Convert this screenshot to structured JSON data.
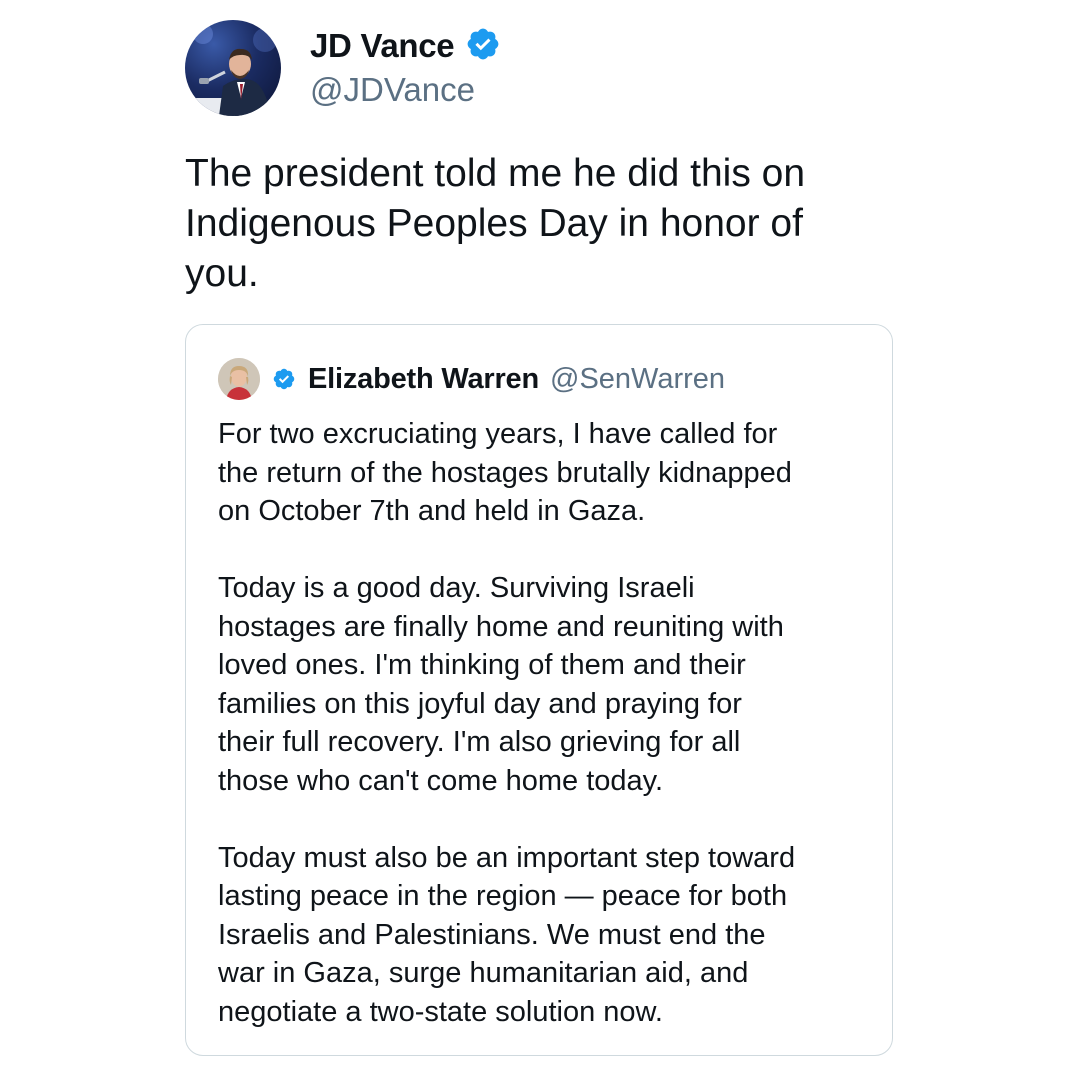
{
  "tweet": {
    "author": {
      "display_name": "JD Vance",
      "handle": "@JDVance",
      "verified": true,
      "avatar_icon": "profile-photo-jd-vance"
    },
    "text": "The president told me he did this on\nIndigenous Peoples Day in honor of\nyou."
  },
  "quoted_tweet": {
    "author": {
      "display_name": "Elizabeth Warren",
      "handle": "@SenWarren",
      "verified": true,
      "avatar_icon": "profile-photo-elizabeth-warren"
    },
    "paragraphs": [
      "For two excruciating years, I have called for\nthe return of the hostages brutally kidnapped\non October 7th and held in Gaza.",
      "Today is a good day. Surviving Israeli\nhostages are finally home and reuniting with\nloved ones. I'm thinking of them and their\nfamilies on this joyful day and praying for\ntheir full recovery. I'm also grieving for all\nthose who can't come home today.",
      "Today must also be an important step toward\nlasting peace in the region — peace for both\nIsraelis and Palestinians. We must end the\nwar in Gaza, surge humanitarian aid, and\nnegotiate a two-state solution now."
    ]
  },
  "colors": {
    "verified_badge": "#1d9bf0",
    "text_primary": "#0f1419",
    "text_secondary": "#5b7083",
    "border": "#cfd9de"
  }
}
